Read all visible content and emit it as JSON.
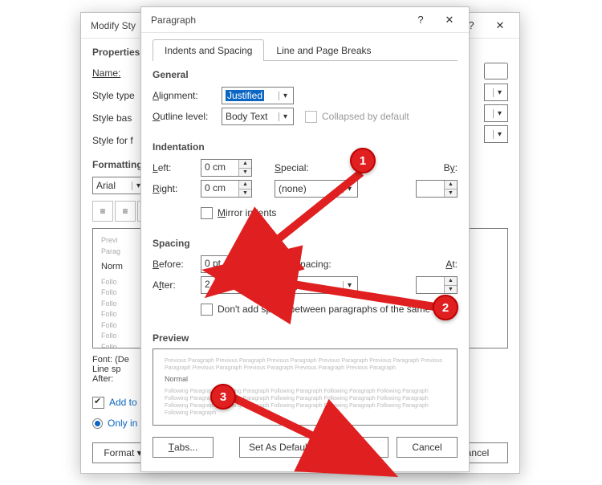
{
  "modify": {
    "title": "Modify Sty",
    "properties": "Properties",
    "name_label": "Name:",
    "style_type_label": "Style type",
    "style_based_label": "Style bas",
    "style_for_label": "Style for f",
    "formatting": "Formatting",
    "font": "Arial",
    "preview_lines": {
      "l1": "Previ",
      "l2": "Parag",
      "l3": "Norm",
      "l4": "Follo"
    },
    "footer_desc": "Font: (De\nLine sp\nAfter:",
    "add_to": "Add to",
    "only_in": "Only in",
    "format_btn": "Format ▾",
    "cancel_btn": "ancel"
  },
  "para": {
    "title": "Paragraph",
    "tab1": "Indents and Spacing",
    "tab2": "Line and Page Breaks",
    "general": "General",
    "alignment": "Alignment:",
    "alignment_val": "Justified",
    "outline": "Outline level:",
    "outline_val": "Body Text",
    "collapsed": "Collapsed by default",
    "indentation": "Indentation",
    "left": "Left:",
    "left_val": "0 cm",
    "right": "Right:",
    "right_val": "0 cm",
    "special": "Special:",
    "special_val": "(none)",
    "by": "By:",
    "mirror": "Mirror indents",
    "spacing": "Spacing",
    "before": "Before:",
    "before_val": "0 pt",
    "after": "After:",
    "after_val": "2 pt",
    "line_spacing": "Line spacing:",
    "line_spacing_val": "Single",
    "at": "At:",
    "dont_add": "Don't add space between paragraphs of the same style",
    "preview_title": "Preview",
    "preview_grey": "Previous Paragraph Previous Paragraph Previous Paragraph Previous Paragraph Previous Paragraph Previous Paragraph Previous Paragraph Previous Paragraph Previous Paragraph Previous Paragraph",
    "preview_norm": "Normal",
    "preview_follow": "Following Paragraph Following Paragraph Following Paragraph Following Paragraph Following Paragraph Following Paragraph Following Paragraph Following Paragraph Following Paragraph Following Paragraph Following Paragraph Following Paragraph Following Paragraph Following Paragraph Following Paragraph Following Paragraph",
    "tabs_btn": "Tabs...",
    "default_btn": "Set As Default",
    "ok_btn": "OK",
    "cancel_btn": "Cancel"
  },
  "badges": {
    "b1": "1",
    "b2": "2",
    "b3": "3"
  }
}
